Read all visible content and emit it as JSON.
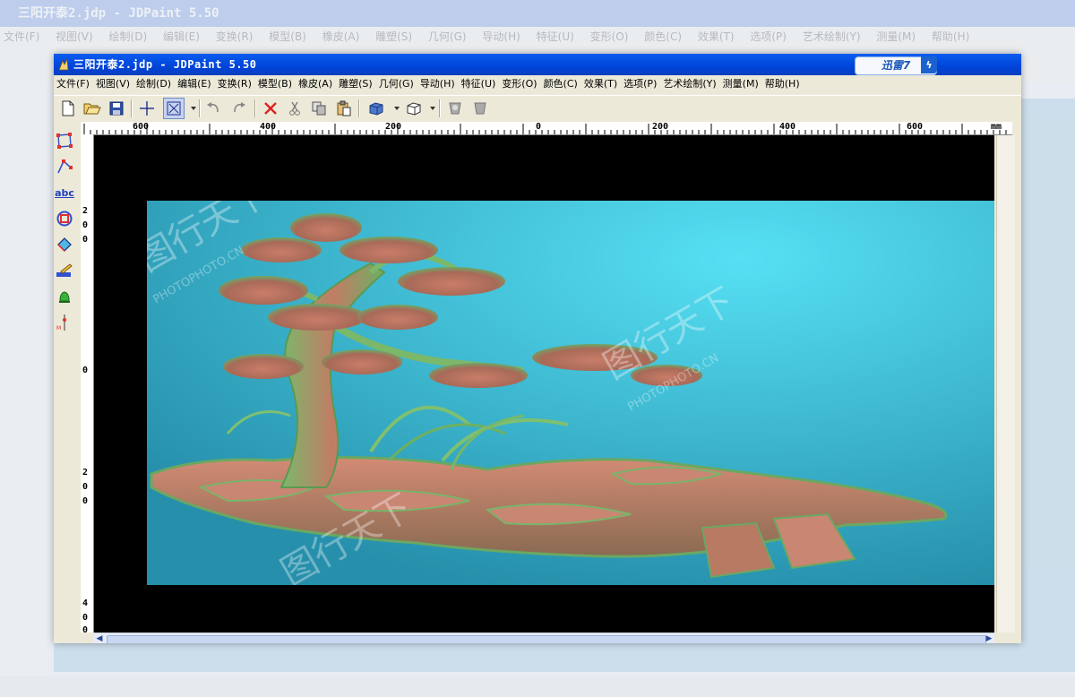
{
  "window": {
    "title": "三阳开泰2.jdp - JDPaint 5.50",
    "xunlei_badge": "迅雷7",
    "titlebar_color": "#0a52e6"
  },
  "menu": {
    "items": [
      "文件(F)",
      "视图(V)",
      "绘制(D)",
      "编辑(E)",
      "变换(R)",
      "模型(B)",
      "橡皮(A)",
      "雕塑(S)",
      "几何(G)",
      "导动(H)",
      "特征(U)",
      "变形(O)",
      "颜色(C)",
      "效果(T)",
      "选项(P)",
      "艺术绘制(Y)",
      "测量(M)",
      "帮助(H)"
    ]
  },
  "toolbar": {
    "icons": [
      "new-file-icon",
      "open-file-icon",
      "save-icon",
      "crosshair-icon",
      "select-box-icon",
      "undo-icon",
      "redo-icon",
      "delete-icon",
      "cut-icon",
      "copy-icon",
      "paste-icon",
      "cube-view-icon",
      "cube-wire-icon",
      "relief-shade-icon",
      "relief-mask-icon"
    ]
  },
  "left_tools": {
    "icons": [
      "node-edit-icon",
      "polyline-icon",
      "text-abc-icon",
      "ring-shape-icon",
      "eraser-icon",
      "paint-brush-icon",
      "bell-shape-icon",
      "measure-icon"
    ],
    "abc_label": "abc"
  },
  "ruler": {
    "h_labels": [
      "600",
      "400",
      "200",
      "0",
      "200",
      "400",
      "600"
    ],
    "unit": "mm",
    "v_labels": [
      "2",
      "0",
      "0",
      "0",
      "2",
      "0",
      "0",
      "4",
      "0",
      "0"
    ]
  },
  "canvas": {
    "background": "#000000",
    "relief_bg_top": "#4ad2ea",
    "relief_bg_bottom": "#2a9cb6"
  },
  "watermark": {
    "main": "图行天下",
    "sub": "PHOTOPHOTO.CN"
  },
  "ghost": {
    "title": "三阳开泰2.jdp - JDPaint 5.50"
  }
}
